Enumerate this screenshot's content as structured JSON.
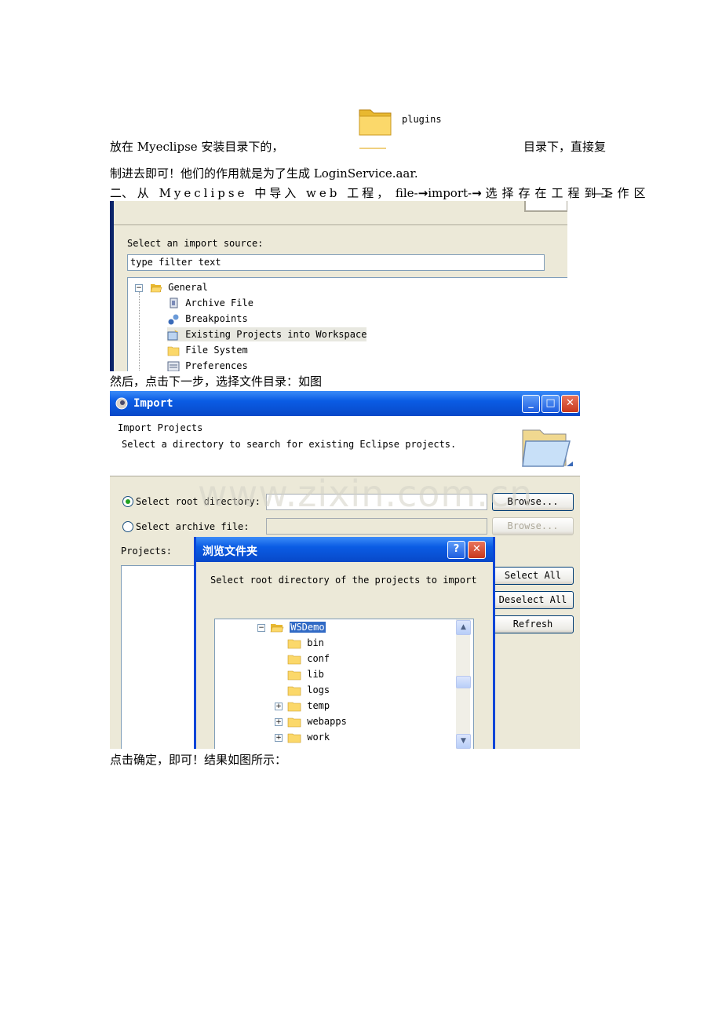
{
  "plugins": {
    "label": "plugins"
  },
  "para1": {
    "left": "放在 Myeclipse 安装目录下的，",
    "right": "目录下，直接复"
  },
  "para2": "制进去即可！他们的作用就是为了生成 LoginService.aar.",
  "para3": {
    "num": "二、",
    "text_a": "从 Myeclipse 中导入 web 工程，",
    "file": "file-",
    "import": "import-",
    "text_b": "选择存在工程到工作区",
    "arrow_end": "—>",
    "arrow_icon": "→"
  },
  "shot1": {
    "select_label": "Select an import source:",
    "filter_value": "type filter text",
    "tree": [
      {
        "label": "General",
        "icon": "folder-open-icon"
      },
      {
        "label": "Archive File",
        "icon": "archive-icon"
      },
      {
        "label": "Breakpoints",
        "icon": "breakpoints-icon"
      },
      {
        "label": "Existing Projects into Workspace",
        "icon": "project-import-icon"
      },
      {
        "label": "File System",
        "icon": "folder-icon"
      },
      {
        "label": "Preferences",
        "icon": "preferences-icon"
      }
    ]
  },
  "para4": "然后，点击下一步，选择文件目录：如图",
  "shot2": {
    "title": "Import",
    "header_title": "Import Projects",
    "header_desc": "Select a directory to search for existing Eclipse projects.",
    "radio_root": "Select root directory:",
    "radio_archive": "Select archive file:",
    "browse1": "Browse...",
    "browse2": "Browse...",
    "projects_label": "Projects:",
    "select_all": "Select All",
    "deselect_all": "Deselect All",
    "refresh": "Refresh",
    "watermark": "www.zixin.com.cn",
    "dialog": {
      "title": "浏览文件夹",
      "help": "?",
      "close": "✕",
      "prompt": "Select root directory of the projects to import",
      "tree": [
        {
          "label": "WSDemo",
          "expanded": true,
          "selected": true
        },
        {
          "label": "bin"
        },
        {
          "label": "conf"
        },
        {
          "label": "lib"
        },
        {
          "label": "logs"
        },
        {
          "label": "temp",
          "expandable": true
        },
        {
          "label": "webapps",
          "expandable": true
        },
        {
          "label": "work",
          "expandable": true
        }
      ]
    }
  },
  "para5": "点击确定，即可！结果如图所示："
}
